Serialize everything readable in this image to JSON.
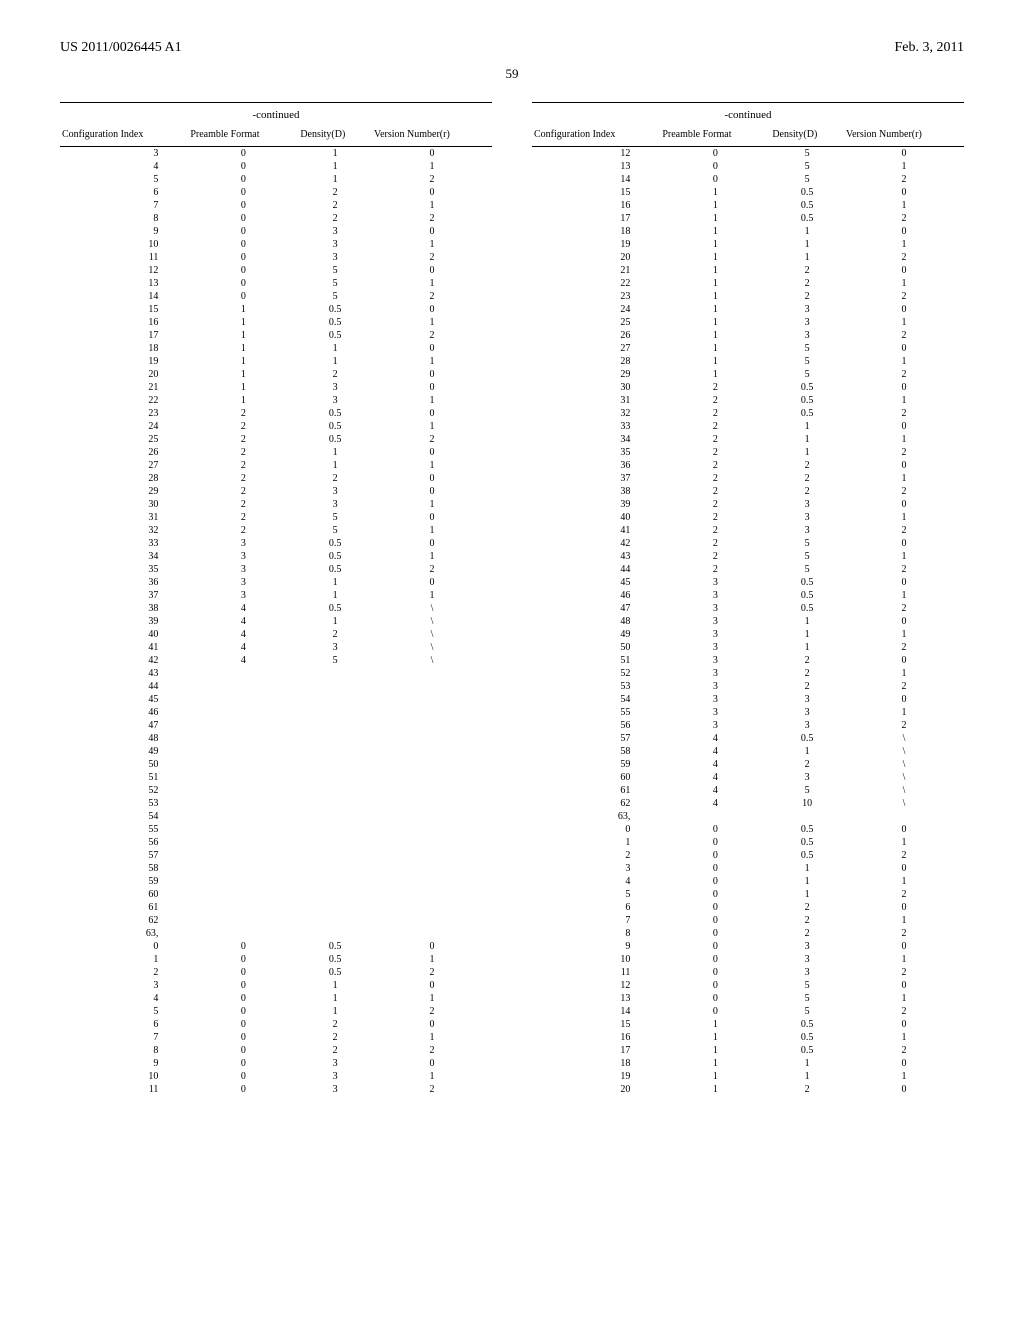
{
  "header": {
    "pub_number": "US 2011/0026445 A1",
    "pub_date": "Feb. 3, 2011",
    "page": "59"
  },
  "table_headers": {
    "continued": "-continued",
    "col1": "Configuration Index",
    "col2": "Preamble Format",
    "col3": "Density(D)",
    "col4": "Version Number(r)"
  },
  "left_rows": [
    [
      "3",
      "0",
      "1",
      "0"
    ],
    [
      "4",
      "0",
      "1",
      "1"
    ],
    [
      "5",
      "0",
      "1",
      "2"
    ],
    [
      "6",
      "0",
      "2",
      "0"
    ],
    [
      "7",
      "0",
      "2",
      "1"
    ],
    [
      "8",
      "0",
      "2",
      "2"
    ],
    [
      "9",
      "0",
      "3",
      "0"
    ],
    [
      "10",
      "0",
      "3",
      "1"
    ],
    [
      "11",
      "0",
      "3",
      "2"
    ],
    [
      "12",
      "0",
      "5",
      "0"
    ],
    [
      "13",
      "0",
      "5",
      "1"
    ],
    [
      "14",
      "0",
      "5",
      "2"
    ],
    [
      "15",
      "1",
      "0.5",
      "0"
    ],
    [
      "16",
      "1",
      "0.5",
      "1"
    ],
    [
      "17",
      "1",
      "0.5",
      "2"
    ],
    [
      "18",
      "1",
      "1",
      "0"
    ],
    [
      "19",
      "1",
      "1",
      "1"
    ],
    [
      "20",
      "1",
      "2",
      "0"
    ],
    [
      "21",
      "1",
      "3",
      "0"
    ],
    [
      "22",
      "1",
      "3",
      "1"
    ],
    [
      "23",
      "2",
      "0.5",
      "0"
    ],
    [
      "24",
      "2",
      "0.5",
      "1"
    ],
    [
      "25",
      "2",
      "0.5",
      "2"
    ],
    [
      "26",
      "2",
      "1",
      "0"
    ],
    [
      "27",
      "2",
      "1",
      "1"
    ],
    [
      "28",
      "2",
      "2",
      "0"
    ],
    [
      "29",
      "2",
      "3",
      "0"
    ],
    [
      "30",
      "2",
      "3",
      "1"
    ],
    [
      "31",
      "2",
      "5",
      "0"
    ],
    [
      "32",
      "2",
      "5",
      "1"
    ],
    [
      "33",
      "3",
      "0.5",
      "0"
    ],
    [
      "34",
      "3",
      "0.5",
      "1"
    ],
    [
      "35",
      "3",
      "0.5",
      "2"
    ],
    [
      "36",
      "3",
      "1",
      "0"
    ],
    [
      "37",
      "3",
      "1",
      "1"
    ],
    [
      "38",
      "4",
      "0.5",
      "\\"
    ],
    [
      "39",
      "4",
      "1",
      "\\"
    ],
    [
      "40",
      "4",
      "2",
      "\\"
    ],
    [
      "41",
      "4",
      "3",
      "\\"
    ],
    [
      "42",
      "4",
      "5",
      "\\"
    ],
    [
      "43",
      "",
      "",
      ""
    ],
    [
      "44",
      "",
      "",
      ""
    ],
    [
      "45",
      "",
      "",
      ""
    ],
    [
      "46",
      "",
      "",
      ""
    ],
    [
      "47",
      "",
      "",
      ""
    ],
    [
      "48",
      "",
      "",
      ""
    ],
    [
      "49",
      "",
      "",
      ""
    ],
    [
      "50",
      "",
      "",
      ""
    ],
    [
      "51",
      "",
      "",
      ""
    ],
    [
      "52",
      "",
      "",
      ""
    ],
    [
      "53",
      "",
      "",
      ""
    ],
    [
      "54",
      "",
      "",
      ""
    ],
    [
      "55",
      "",
      "",
      ""
    ],
    [
      "56",
      "",
      "",
      ""
    ],
    [
      "57",
      "",
      "",
      ""
    ],
    [
      "58",
      "",
      "",
      ""
    ],
    [
      "59",
      "",
      "",
      ""
    ],
    [
      "60",
      "",
      "",
      ""
    ],
    [
      "61",
      "",
      "",
      ""
    ],
    [
      "62",
      "",
      "",
      ""
    ],
    [
      "63,",
      "",
      "",
      ""
    ],
    [
      "0",
      "0",
      "0.5",
      "0"
    ],
    [
      "1",
      "0",
      "0.5",
      "1"
    ],
    [
      "2",
      "0",
      "0.5",
      "2"
    ],
    [
      "3",
      "0",
      "1",
      "0"
    ],
    [
      "4",
      "0",
      "1",
      "1"
    ],
    [
      "5",
      "0",
      "1",
      "2"
    ],
    [
      "6",
      "0",
      "2",
      "0"
    ],
    [
      "7",
      "0",
      "2",
      "1"
    ],
    [
      "8",
      "0",
      "2",
      "2"
    ],
    [
      "9",
      "0",
      "3",
      "0"
    ],
    [
      "10",
      "0",
      "3",
      "1"
    ],
    [
      "11",
      "0",
      "3",
      "2"
    ]
  ],
  "right_rows": [
    [
      "12",
      "0",
      "5",
      "0"
    ],
    [
      "13",
      "0",
      "5",
      "1"
    ],
    [
      "14",
      "0",
      "5",
      "2"
    ],
    [
      "15",
      "1",
      "0.5",
      "0"
    ],
    [
      "16",
      "1",
      "0.5",
      "1"
    ],
    [
      "17",
      "1",
      "0.5",
      "2"
    ],
    [
      "18",
      "1",
      "1",
      "0"
    ],
    [
      "19",
      "1",
      "1",
      "1"
    ],
    [
      "20",
      "1",
      "1",
      "2"
    ],
    [
      "21",
      "1",
      "2",
      "0"
    ],
    [
      "22",
      "1",
      "2",
      "1"
    ],
    [
      "23",
      "1",
      "2",
      "2"
    ],
    [
      "24",
      "1",
      "3",
      "0"
    ],
    [
      "25",
      "1",
      "3",
      "1"
    ],
    [
      "26",
      "1",
      "3",
      "2"
    ],
    [
      "27",
      "1",
      "5",
      "0"
    ],
    [
      "28",
      "1",
      "5",
      "1"
    ],
    [
      "29",
      "1",
      "5",
      "2"
    ],
    [
      "30",
      "2",
      "0.5",
      "0"
    ],
    [
      "31",
      "2",
      "0.5",
      "1"
    ],
    [
      "32",
      "2",
      "0.5",
      "2"
    ],
    [
      "33",
      "2",
      "1",
      "0"
    ],
    [
      "34",
      "2",
      "1",
      "1"
    ],
    [
      "35",
      "2",
      "1",
      "2"
    ],
    [
      "36",
      "2",
      "2",
      "0"
    ],
    [
      "37",
      "2",
      "2",
      "1"
    ],
    [
      "38",
      "2",
      "2",
      "2"
    ],
    [
      "39",
      "2",
      "3",
      "0"
    ],
    [
      "40",
      "2",
      "3",
      "1"
    ],
    [
      "41",
      "2",
      "3",
      "2"
    ],
    [
      "42",
      "2",
      "5",
      "0"
    ],
    [
      "43",
      "2",
      "5",
      "1"
    ],
    [
      "44",
      "2",
      "5",
      "2"
    ],
    [
      "45",
      "3",
      "0.5",
      "0"
    ],
    [
      "46",
      "3",
      "0.5",
      "1"
    ],
    [
      "47",
      "3",
      "0.5",
      "2"
    ],
    [
      "48",
      "3",
      "1",
      "0"
    ],
    [
      "49",
      "3",
      "1",
      "1"
    ],
    [
      "50",
      "3",
      "1",
      "2"
    ],
    [
      "51",
      "3",
      "2",
      "0"
    ],
    [
      "52",
      "3",
      "2",
      "1"
    ],
    [
      "53",
      "3",
      "2",
      "2"
    ],
    [
      "54",
      "3",
      "3",
      "0"
    ],
    [
      "55",
      "3",
      "3",
      "1"
    ],
    [
      "56",
      "3",
      "3",
      "2"
    ],
    [
      "57",
      "4",
      "0.5",
      "\\"
    ],
    [
      "58",
      "4",
      "1",
      "\\"
    ],
    [
      "59",
      "4",
      "2",
      "\\"
    ],
    [
      "60",
      "4",
      "3",
      "\\"
    ],
    [
      "61",
      "4",
      "5",
      "\\"
    ],
    [
      "62",
      "4",
      "10",
      "\\"
    ],
    [
      "63,",
      "",
      "",
      ""
    ],
    [
      "0",
      "0",
      "0.5",
      "0"
    ],
    [
      "1",
      "0",
      "0.5",
      "1"
    ],
    [
      "2",
      "0",
      "0.5",
      "2"
    ],
    [
      "3",
      "0",
      "1",
      "0"
    ],
    [
      "4",
      "0",
      "1",
      "1"
    ],
    [
      "5",
      "0",
      "1",
      "2"
    ],
    [
      "6",
      "0",
      "2",
      "0"
    ],
    [
      "7",
      "0",
      "2",
      "1"
    ],
    [
      "8",
      "0",
      "2",
      "2"
    ],
    [
      "9",
      "0",
      "3",
      "0"
    ],
    [
      "10",
      "0",
      "3",
      "1"
    ],
    [
      "11",
      "0",
      "3",
      "2"
    ],
    [
      "12",
      "0",
      "5",
      "0"
    ],
    [
      "13",
      "0",
      "5",
      "1"
    ],
    [
      "14",
      "0",
      "5",
      "2"
    ],
    [
      "15",
      "1",
      "0.5",
      "0"
    ],
    [
      "16",
      "1",
      "0.5",
      "1"
    ],
    [
      "17",
      "1",
      "0.5",
      "2"
    ],
    [
      "18",
      "1",
      "1",
      "0"
    ],
    [
      "19",
      "1",
      "1",
      "1"
    ],
    [
      "20",
      "1",
      "2",
      "0"
    ]
  ]
}
